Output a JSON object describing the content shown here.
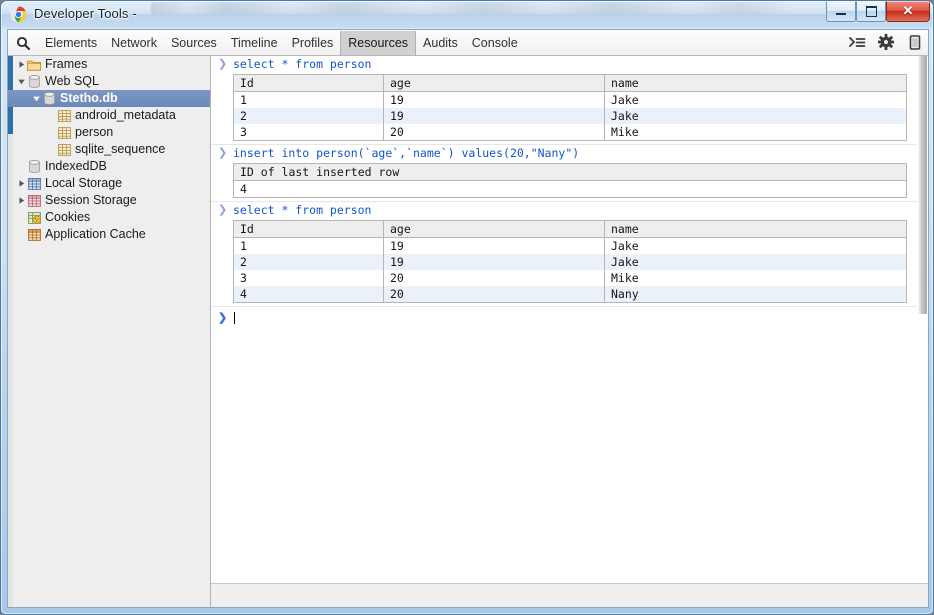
{
  "window": {
    "title": "Developer Tools -",
    "app_icon": "chrome-icon",
    "controls": {
      "minimize": "minimize-icon",
      "maximize": "maximize-icon",
      "close": "close-icon",
      "close_glyph": "✕"
    }
  },
  "toolbar": {
    "search_icon": "search-icon",
    "tabs": [
      {
        "label": "Elements",
        "selected": false
      },
      {
        "label": "Network",
        "selected": false
      },
      {
        "label": "Sources",
        "selected": false
      },
      {
        "label": "Timeline",
        "selected": false
      },
      {
        "label": "Profiles",
        "selected": false
      },
      {
        "label": "Resources",
        "selected": true
      },
      {
        "label": "Audits",
        "selected": false
      },
      {
        "label": "Console",
        "selected": false
      }
    ],
    "right_icons": [
      {
        "name": "console-drawer-icon",
        "glyph": "≻≡"
      },
      {
        "name": "settings-gear-icon",
        "glyph": "⚙"
      },
      {
        "name": "dock-side-icon",
        "glyph": "⎕"
      }
    ]
  },
  "sidebar": {
    "items": [
      {
        "label": "Frames",
        "icon": "folder-icon",
        "indent": 0,
        "disclosure": "collapsed",
        "selected": false
      },
      {
        "label": "Web SQL",
        "icon": "database-icon",
        "indent": 0,
        "disclosure": "expanded",
        "selected": false
      },
      {
        "label": "Stetho.db",
        "icon": "database-icon",
        "indent": 1,
        "disclosure": "expanded",
        "selected": true
      },
      {
        "label": "android_metadata",
        "icon": "table-icon",
        "indent": 2,
        "disclosure": "none",
        "selected": false
      },
      {
        "label": "person",
        "icon": "table-icon",
        "indent": 2,
        "disclosure": "none",
        "selected": false
      },
      {
        "label": "sqlite_sequence",
        "icon": "table-icon",
        "indent": 2,
        "disclosure": "none",
        "selected": false
      },
      {
        "label": "IndexedDB",
        "icon": "database-icon",
        "indent": 0,
        "disclosure": "none",
        "selected": false
      },
      {
        "label": "Local Storage",
        "icon": "local-storage-icon",
        "indent": 0,
        "disclosure": "collapsed",
        "selected": false
      },
      {
        "label": "Session Storage",
        "icon": "session-storage-icon",
        "indent": 0,
        "disclosure": "collapsed",
        "selected": false
      },
      {
        "label": "Cookies",
        "icon": "cookies-icon",
        "indent": 0,
        "disclosure": "none",
        "selected": false
      },
      {
        "label": "Application Cache",
        "icon": "app-cache-icon",
        "indent": 0,
        "disclosure": "none",
        "selected": false
      }
    ]
  },
  "console": {
    "prompt_glyph": "❯",
    "entries": [
      {
        "type": "query",
        "command": "select * from person",
        "table": {
          "headers": [
            "Id",
            "age",
            "name"
          ],
          "rows": [
            [
              "1",
              "19",
              "Jake"
            ],
            [
              "2",
              "19",
              "Jake"
            ],
            [
              "3",
              "20",
              "Mike"
            ]
          ]
        }
      },
      {
        "type": "query",
        "command": "insert into person(`age`,`name`) values(20,\"Nany\")",
        "table": {
          "headers": [
            "ID of last inserted row"
          ],
          "rows": [
            [
              "4"
            ]
          ]
        }
      },
      {
        "type": "query",
        "command": "select * from person",
        "table": {
          "headers": [
            "Id",
            "age",
            "name"
          ],
          "rows": [
            [
              "1",
              "19",
              "Jake"
            ],
            [
              "2",
              "19",
              "Jake"
            ],
            [
              "3",
              "20",
              "Mike"
            ],
            [
              "4",
              "20",
              "Nany"
            ]
          ]
        }
      }
    ],
    "input_value": ""
  },
  "colors": {
    "accent_blue": "#1155cc",
    "selection_blue": "#6c89ba",
    "prompt_blue": "#3b73d6",
    "row_alt": "#eaf1fb",
    "header_gray": "#eeeeee",
    "sidebar_bg": "#eeeeee",
    "titlebar_close": "#c32e18"
  }
}
